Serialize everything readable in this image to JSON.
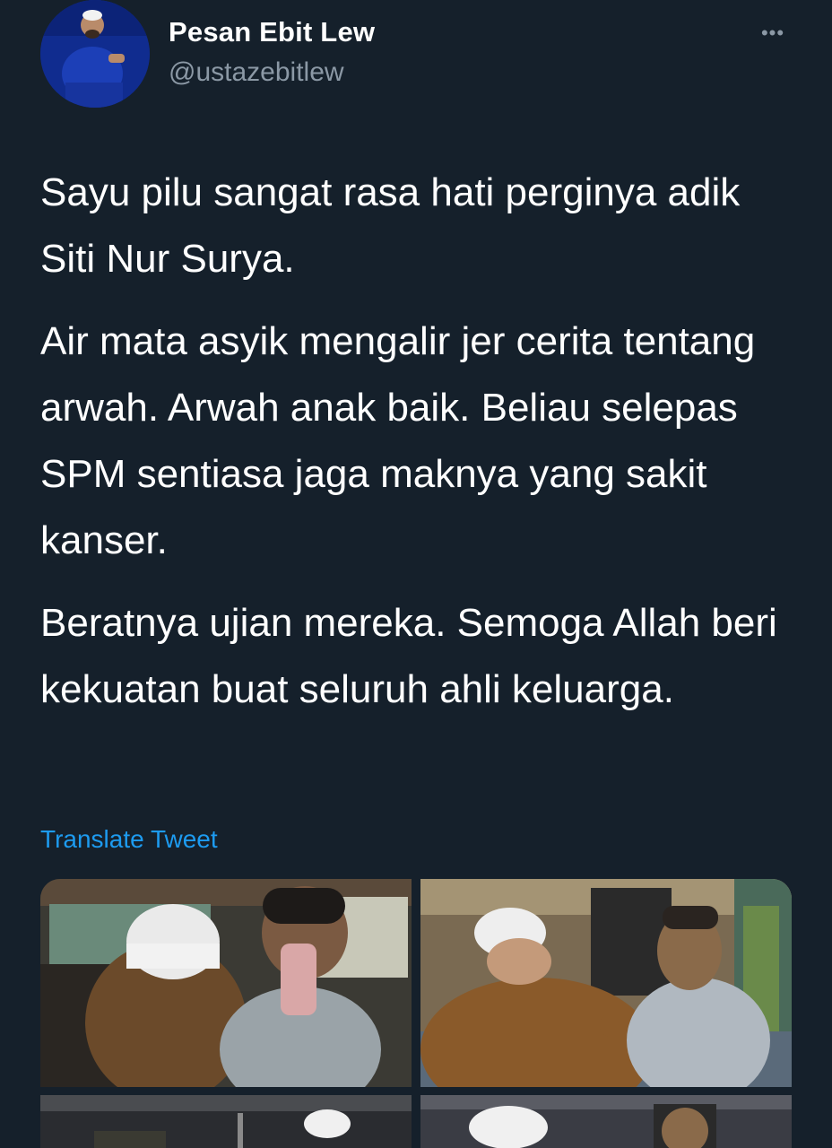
{
  "tweet": {
    "author": {
      "display_name": "Pesan Ebit Lew",
      "handle": "@ustazebitlew",
      "avatar_icon": "profile-photo"
    },
    "more_icon": "more-horizontal-icon",
    "paragraphs": [
      "Sayu pilu sangat rasa hati perginya adik Siti Nur Surya.",
      "Air mata asyik mengalir jer cerita tentang arwah. Arwah anak baik. Beliau selepas SPM sentiasa jaga maknya yang sakit kanser.",
      "Beratnya ujian mereka. Semoga Allah beri kekuatan buat seluruh ahli keluarga."
    ],
    "translate_label": "Translate Tweet"
  },
  "colors": {
    "background": "#15202b",
    "text": "#ffffff",
    "secondary": "#8b98a5",
    "link": "#1d9bf0"
  }
}
